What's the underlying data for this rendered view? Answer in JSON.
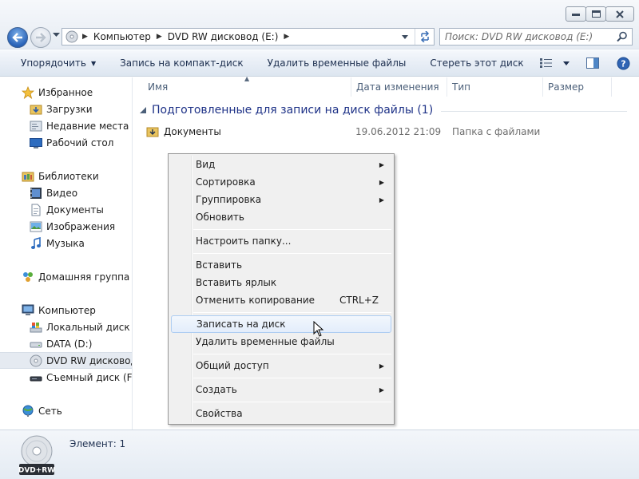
{
  "window": {
    "minimize": "minimize",
    "maximize": "maximize",
    "close": "close"
  },
  "address": {
    "crumbs": [
      "Компьютер",
      "DVD RW дисковод (E:)"
    ]
  },
  "search": {
    "placeholder": "Поиск: DVD RW дисковод (E:)"
  },
  "toolbar": {
    "organize": "Упорядочить",
    "burn": "Запись на компакт-диск",
    "delete_temp": "Удалить временные файлы",
    "erase": "Стереть этот диск"
  },
  "nav": {
    "favorites": "Избранное",
    "downloads": "Загрузки",
    "recent": "Недавние места",
    "desktop": "Рабочий стол",
    "libraries": "Библиотеки",
    "video": "Видео",
    "documents": "Документы",
    "images": "Изображения",
    "music": "Музыка",
    "homegroup": "Домашняя группа",
    "computer": "Компьютер",
    "local_disk": "Локальный диск (С",
    "data_disk": "DATA (D:)",
    "dvd_disk": "DVD RW дисковод (",
    "removable": "Съемный диск (F:)",
    "network": "Сеть"
  },
  "columns": {
    "name": "Имя",
    "date": "Дата изменения",
    "type": "Тип",
    "size": "Размер"
  },
  "group": {
    "title": "Подготовленные для записи на диск файлы (1)"
  },
  "files": [
    {
      "name": "Документы",
      "date": "19.06.2012 21:09",
      "type": "Папка с файлами"
    }
  ],
  "context_menu": {
    "view": "Вид",
    "sort": "Сортировка",
    "group": "Группировка",
    "refresh": "Обновить",
    "customize": "Настроить папку...",
    "paste": "Вставить",
    "paste_shortcut": "Вставить ярлык",
    "undo_copy": "Отменить копирование",
    "undo_shortcut": "CTRL+Z",
    "burn": "Записать на диск",
    "delete_temp": "Удалить временные файлы",
    "share": "Общий доступ",
    "create": "Создать",
    "properties": "Свойства"
  },
  "status": {
    "items": "Элемент: 1",
    "drive_label": "DVD+RW"
  }
}
